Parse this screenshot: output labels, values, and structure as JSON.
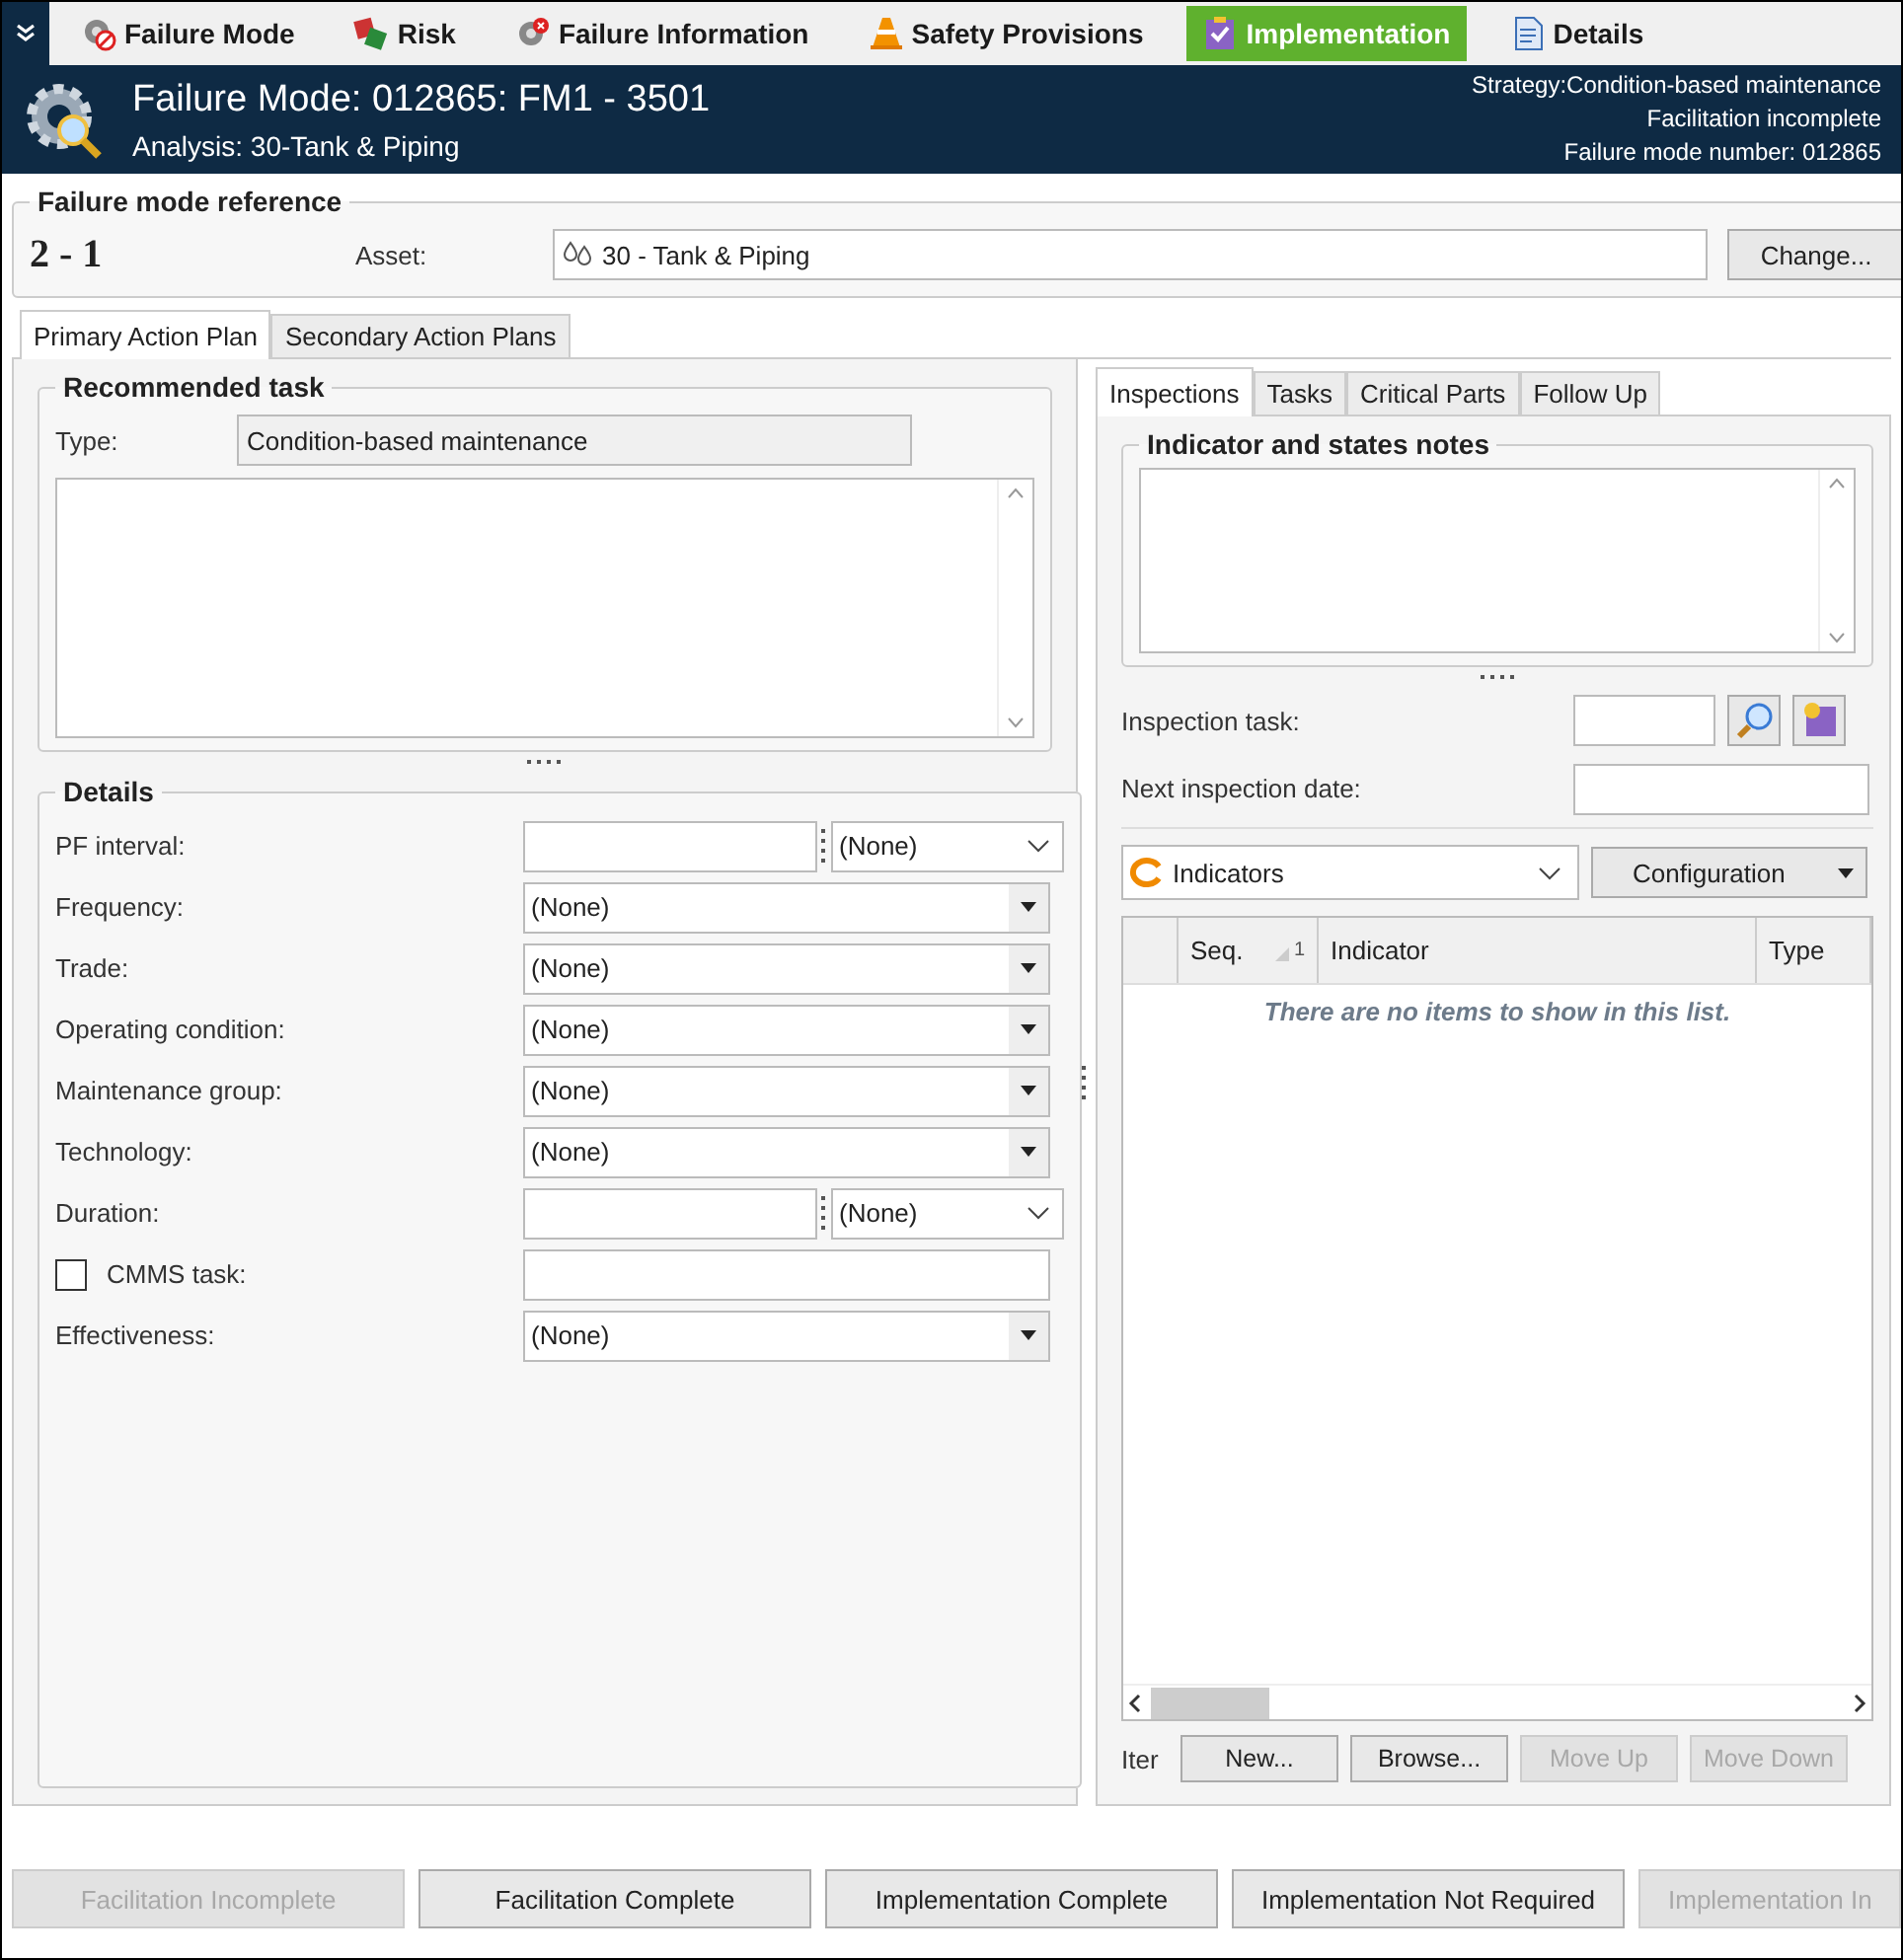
{
  "nav_tabs": [
    {
      "label": "Failure Mode",
      "selected": false
    },
    {
      "label": "Risk",
      "selected": false
    },
    {
      "label": "Failure Information",
      "selected": false
    },
    {
      "label": "Safety Provisions",
      "selected": false
    },
    {
      "label": "Implementation",
      "selected": true
    },
    {
      "label": "Details",
      "selected": false
    }
  ],
  "header": {
    "title": "Failure Mode: 012865: FM1 - 3501",
    "subtitle": "Analysis: 30-Tank & Piping",
    "info": [
      "Strategy:Condition-based maintenance",
      "Facilitation incomplete",
      "Failure mode number: 012865"
    ]
  },
  "reference": {
    "title": "Failure mode reference",
    "number": "2 - 1",
    "asset_label": "Asset:",
    "asset_value": "30 - Tank & Piping",
    "change_button": "Change..."
  },
  "plan_tabs": [
    {
      "label": "Primary Action Plan",
      "selected": true
    },
    {
      "label": "Secondary Action Plans",
      "selected": false
    }
  ],
  "recommended_task": {
    "title": "Recommended task",
    "type_label": "Type:",
    "type_value": "Condition-based maintenance"
  },
  "details": {
    "title": "Details",
    "rows": [
      {
        "kind": "split",
        "label": "PF interval:",
        "value": "(None)"
      },
      {
        "kind": "dropdown",
        "label": "Frequency:",
        "value": "(None)"
      },
      {
        "kind": "dropdown",
        "label": "Trade:",
        "value": "(None)"
      },
      {
        "kind": "dropdown",
        "label": "Operating condition:",
        "value": "(None)"
      },
      {
        "kind": "dropdown",
        "label": "Maintenance group:",
        "value": "(None)"
      },
      {
        "kind": "dropdown",
        "label": "Technology:",
        "value": "(None)"
      },
      {
        "kind": "split",
        "label": "Duration:",
        "value": "(None)"
      },
      {
        "kind": "checkbox",
        "label": "CMMS task:",
        "checked": false
      },
      {
        "kind": "dropdown",
        "label": "Effectiveness:",
        "value": "(None)"
      }
    ]
  },
  "right_tabs": [
    {
      "label": "Inspections",
      "selected": true
    },
    {
      "label": "Tasks",
      "selected": false
    },
    {
      "label": "Critical Parts",
      "selected": false
    },
    {
      "label": "Follow Up",
      "selected": false
    }
  ],
  "notes": {
    "title": "Indicator and states notes"
  },
  "inspection": {
    "task_label": "Inspection task:",
    "date_label": "Next inspection date:"
  },
  "indicators": {
    "dropdown": "Indicators",
    "config_button": "Configuration",
    "columns": [
      {
        "label": "Seq.",
        "sort": "1"
      },
      {
        "label": "Indicator"
      },
      {
        "label": "Type"
      }
    ],
    "empty": "There are no items to show in this list.",
    "items_label": "Iter",
    "buttons": [
      {
        "label": "New...",
        "disabled": false
      },
      {
        "label": "Browse...",
        "disabled": false
      },
      {
        "label": "Move Up",
        "disabled": true
      },
      {
        "label": "Move Down",
        "disabled": true
      }
    ]
  },
  "footer_buttons": [
    {
      "label": "Facilitation Incomplete",
      "disabled": true
    },
    {
      "label": "Facilitation Complete",
      "disabled": false
    },
    {
      "label": "Implementation Complete",
      "disabled": false
    },
    {
      "label": "Implementation Not Required",
      "disabled": false
    },
    {
      "label": "Implementation In",
      "disabled": true
    }
  ]
}
